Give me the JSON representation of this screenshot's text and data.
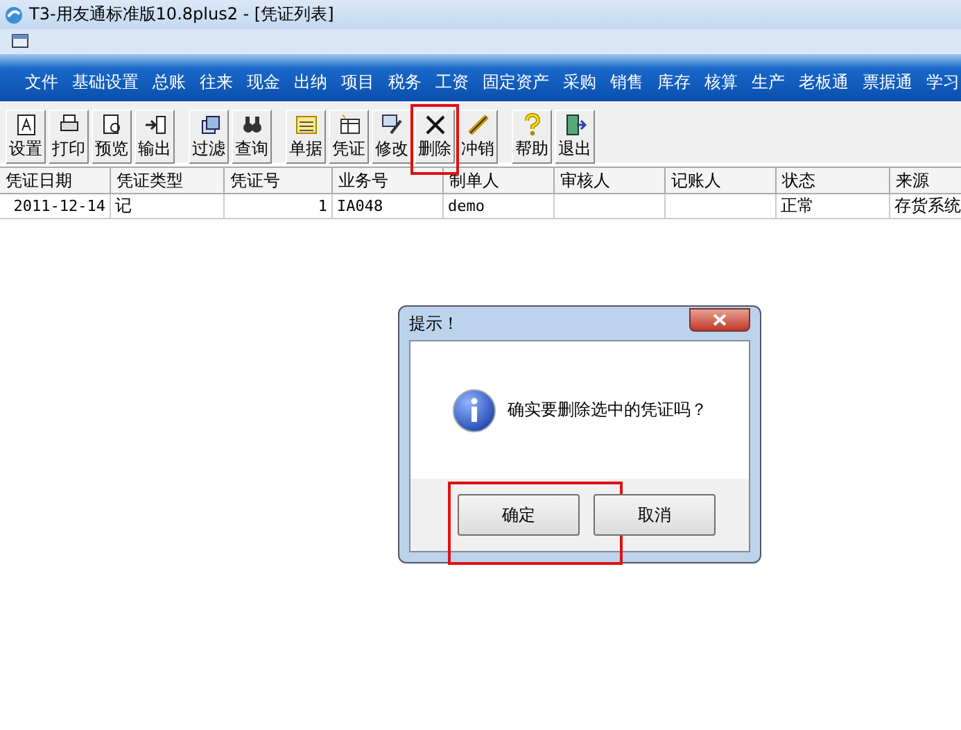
{
  "window": {
    "title": "T3-用友通标准版10.8plus2 - [凭证列表]"
  },
  "menu": [
    "文件",
    "基础设置",
    "总账",
    "往来",
    "现金",
    "出纳",
    "项目",
    "税务",
    "工资",
    "固定资产",
    "采购",
    "销售",
    "库存",
    "核算",
    "生产",
    "老板通",
    "票据通",
    "学习"
  ],
  "toolbar": [
    [
      {
        "label": "设置",
        "highlighted": false
      },
      {
        "label": "打印",
        "highlighted": false
      },
      {
        "label": "预览",
        "highlighted": false
      },
      {
        "label": "输出",
        "highlighted": false
      }
    ],
    [
      {
        "label": "过滤",
        "highlighted": false
      },
      {
        "label": "查询",
        "highlighted": false
      }
    ],
    [
      {
        "label": "单据",
        "highlighted": false
      },
      {
        "label": "凭证",
        "highlighted": false
      },
      {
        "label": "修改",
        "highlighted": false
      },
      {
        "label": "删除",
        "highlighted": true
      },
      {
        "label": "冲销",
        "highlighted": false
      }
    ],
    [
      {
        "label": "帮助",
        "highlighted": false
      },
      {
        "label": "退出",
        "highlighted": false
      }
    ]
  ],
  "table": {
    "columns": [
      "凭证日期",
      "凭证类型",
      "凭证号",
      "业务号",
      "制单人",
      "审核人",
      "记账人",
      "状态",
      "来源"
    ],
    "rows": [
      [
        "2011-12-14",
        "记",
        "1",
        "IA048",
        "demo",
        "",
        "",
        "正常",
        "存货系统"
      ]
    ]
  },
  "dialog": {
    "title": "提示！",
    "message": "确实要删除选中的凭证吗？",
    "buttons": [
      {
        "label": "确定",
        "highlighted": true
      },
      {
        "label": "取消",
        "highlighted": false
      }
    ]
  }
}
